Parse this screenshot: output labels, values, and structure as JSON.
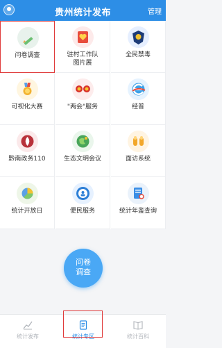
{
  "header": {
    "title": "贵州统计发布",
    "manage": "管理"
  },
  "grid": [
    {
      "label": "问卷调查",
      "icon": "pencil-icon",
      "color": "#e8f2ec"
    },
    {
      "label": "驻村工作队\n图片展",
      "icon": "heart-badge-icon",
      "color": "#fdeaea"
    },
    {
      "label": "全民禁毒",
      "icon": "police-badge-icon",
      "color": "#e6efff"
    },
    {
      "label": "可视化大赛",
      "icon": "medal-icon",
      "color": "#fff6e0"
    },
    {
      "label": "\"两会\"服务",
      "icon": "emblem-icon",
      "color": "#fdecec"
    },
    {
      "label": "经普",
      "icon": "e-logo-icon",
      "color": "#e6f3ff"
    },
    {
      "label": "黔南政务110",
      "icon": "leaf-icon",
      "color": "#fbe9ea"
    },
    {
      "label": "生态文明会议",
      "icon": "globe-icon",
      "color": "#eaf6ec"
    },
    {
      "label": "面访系统",
      "icon": "hands-icon",
      "color": "#fff4e2"
    },
    {
      "label": "统计开放日",
      "icon": "pie-icon",
      "color": "#eef6e8"
    },
    {
      "label": "便民服务",
      "icon": "service-icon",
      "color": "#e6f1ff"
    },
    {
      "label": "统计年鉴查询",
      "icon": "document-search-icon",
      "color": "#eaf2fb"
    }
  ],
  "fab": {
    "line1": "问卷",
    "line2": "调查"
  },
  "tabs": [
    {
      "label": "统计发布",
      "icon": "chart-icon"
    },
    {
      "label": "统计专区",
      "icon": "document-icon"
    },
    {
      "label": "统计百科",
      "icon": "book-icon"
    }
  ]
}
